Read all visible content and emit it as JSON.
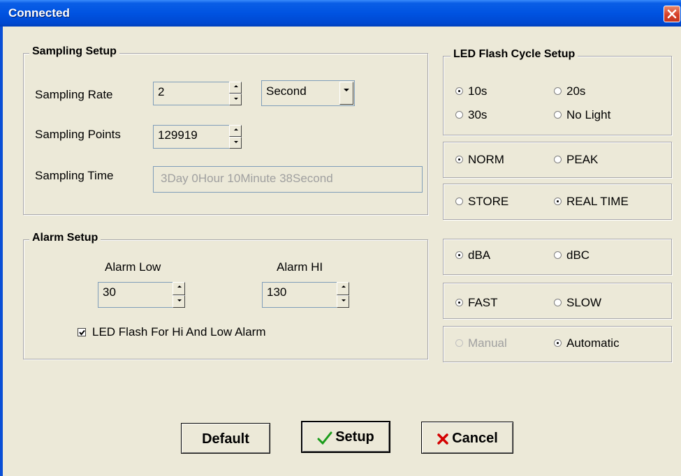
{
  "window": {
    "title": "Connected"
  },
  "sampling": {
    "title": "Sampling Setup",
    "rate_label": "Sampling Rate",
    "rate_value": "2",
    "unit_value": "Second",
    "points_label": "Sampling Points",
    "points_value": "129919",
    "time_label": "Sampling Time",
    "time_value": "3Day 0Hour 10Minute 38Second"
  },
  "alarm": {
    "title": "Alarm Setup",
    "low_label": "Alarm Low",
    "low_value": "30",
    "hi_label": "Alarm HI",
    "hi_value": "130",
    "led_checkbox_label": "LED Flash For Hi And Low  Alarm",
    "led_checked": true
  },
  "led_cycle": {
    "title": "LED Flash Cycle Setup",
    "options": [
      "10s",
      "20s",
      "30s",
      "No Light"
    ],
    "selected": "10s"
  },
  "mode": {
    "options": [
      "NORM",
      "PEAK"
    ],
    "selected": "NORM"
  },
  "record": {
    "options": [
      "STORE",
      "REAL TIME"
    ],
    "selected": "REAL TIME"
  },
  "weighting": {
    "options": [
      "dBA",
      "dBC"
    ],
    "selected": "dBA"
  },
  "response": {
    "options": [
      "FAST",
      "SLOW"
    ],
    "selected": "FAST"
  },
  "range": {
    "options": [
      "Manual",
      "Automatic"
    ],
    "selected": "Automatic",
    "disabled": [
      "Manual"
    ]
  },
  "buttons": {
    "default": "Default",
    "setup": "Setup",
    "cancel": "Cancel"
  },
  "colors": {
    "titlebar": "#0053e1",
    "dialog_bg": "#ece9d8",
    "cancel_x": "#d40000",
    "setup_check": "#1a9c1a"
  }
}
